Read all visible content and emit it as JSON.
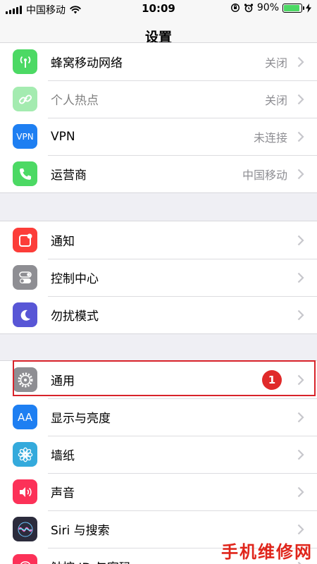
{
  "status_bar": {
    "carrier": "中国移动",
    "time": "10:09",
    "battery": "90%",
    "battery_level": 0.9
  },
  "nav": {
    "title": "设置"
  },
  "groups": [
    {
      "items": [
        {
          "label": "蜂窝移动网络",
          "value": "关闭",
          "icon": "cellular-antenna-icon",
          "color": "#4cd964"
        },
        {
          "label": "个人热点",
          "value": "关闭",
          "icon": "hotspot-link-icon",
          "color": "#4cd964"
        },
        {
          "label": "VPN",
          "value": "未连接",
          "icon": "vpn-icon",
          "icon_text": "VPN",
          "color": "#1e7ff2"
        },
        {
          "label": "运营商",
          "value": "中国移动",
          "icon": "phone-icon",
          "color": "#4cd964"
        }
      ]
    },
    {
      "items": [
        {
          "label": "通知",
          "icon": "notification-icon",
          "color": "#fc3d39"
        },
        {
          "label": "控制中心",
          "icon": "toggle-icon",
          "color": "#8e8e93"
        },
        {
          "label": "勿扰模式",
          "icon": "moon-icon",
          "color": "#5856d6"
        }
      ]
    },
    {
      "items": [
        {
          "label": "通用",
          "icon": "gear-icon",
          "color": "#8e8e93",
          "badge": "1"
        },
        {
          "label": "显示与亮度",
          "icon": "text-size-icon",
          "icon_text": "AA",
          "color": "#1e7ff2"
        },
        {
          "label": "墙纸",
          "icon": "flower-icon",
          "color": "#34aadc"
        },
        {
          "label": "声音",
          "icon": "speaker-icon",
          "color": "#fc3158"
        },
        {
          "label": "Siri 与搜索",
          "icon": "siri-icon",
          "color": "#2b2b3c"
        },
        {
          "label": "触控 ID 与密码",
          "icon": "fingerprint-icon",
          "color": "#fc3158"
        }
      ]
    }
  ],
  "watermark": "手机维修网"
}
